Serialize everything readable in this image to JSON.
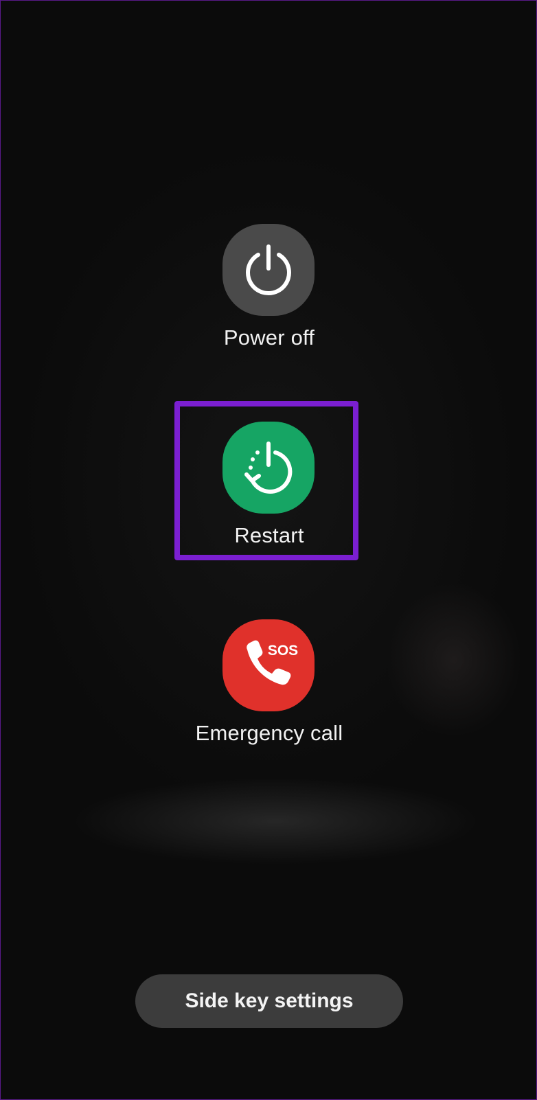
{
  "power_menu": {
    "items": [
      {
        "id": "power_off",
        "label": "Power off",
        "icon": "power-icon",
        "color": "#4a4a4a"
      },
      {
        "id": "restart",
        "label": "Restart",
        "icon": "restart-icon",
        "color": "#16a564",
        "highlighted": true
      },
      {
        "id": "emergency_call",
        "label": "Emergency call",
        "icon": "sos-phone-icon",
        "badge": "SOS",
        "color": "#e0312b"
      }
    ]
  },
  "footer": {
    "side_key_settings_label": "Side key settings"
  },
  "colors": {
    "highlight": "#7b1fd1",
    "background": "#0c0c0c",
    "button_bg": "#3c3c3c"
  }
}
